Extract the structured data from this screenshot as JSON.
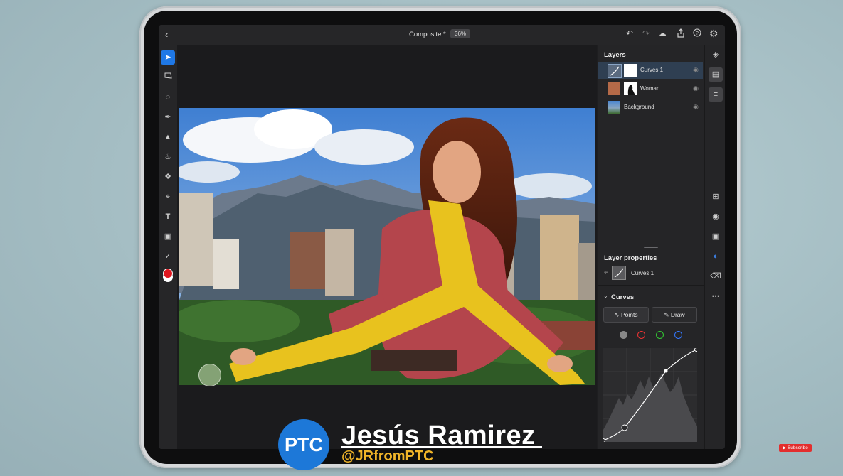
{
  "app": {
    "doc_title": "Composite *",
    "zoom": "36%"
  },
  "topbar": {
    "back_icon": "chevron-left-icon",
    "icons": [
      "undo-icon",
      "redo-icon",
      "cloud-icon",
      "share-icon",
      "help-icon",
      "settings-icon"
    ]
  },
  "tools": [
    "move-icon",
    "lasso-select-icon",
    "quick-select-icon",
    "brush-icon",
    "eraser-icon",
    "fill-icon",
    "healing-icon",
    "crop-icon",
    "type-icon",
    "place-image-icon",
    "eyedropper-icon"
  ],
  "colors": {
    "accent": "#1f78e6",
    "foreground": "#e0161e",
    "background": "#ffffff",
    "selected_layer": "#2f3f52"
  },
  "layers_panel": {
    "title": "Layers",
    "layers": [
      {
        "name": "Curves 1",
        "selected": true
      },
      {
        "name": "Woman",
        "selected": false
      },
      {
        "name": "Background",
        "selected": false
      }
    ]
  },
  "layer_properties": {
    "title": "Layer properties",
    "layer_name": "Curves 1"
  },
  "curves": {
    "title": "Curves",
    "points_label": "Points",
    "draw_label": "Draw",
    "channels": [
      "rgb",
      "red",
      "green",
      "blue"
    ]
  },
  "rail_icons": [
    "layers-icon",
    "layer-stack-icon",
    "adjustments-icon",
    "add-layer-icon",
    "visibility-icon",
    "mask-icon",
    "adjustment-layer-icon",
    "clear-icon",
    "more-icon"
  ],
  "branding": {
    "logo": "PTC",
    "name": "Jesús Ramirez",
    "handle": "@JRfromPTC",
    "subscribe": "Subscribe"
  }
}
